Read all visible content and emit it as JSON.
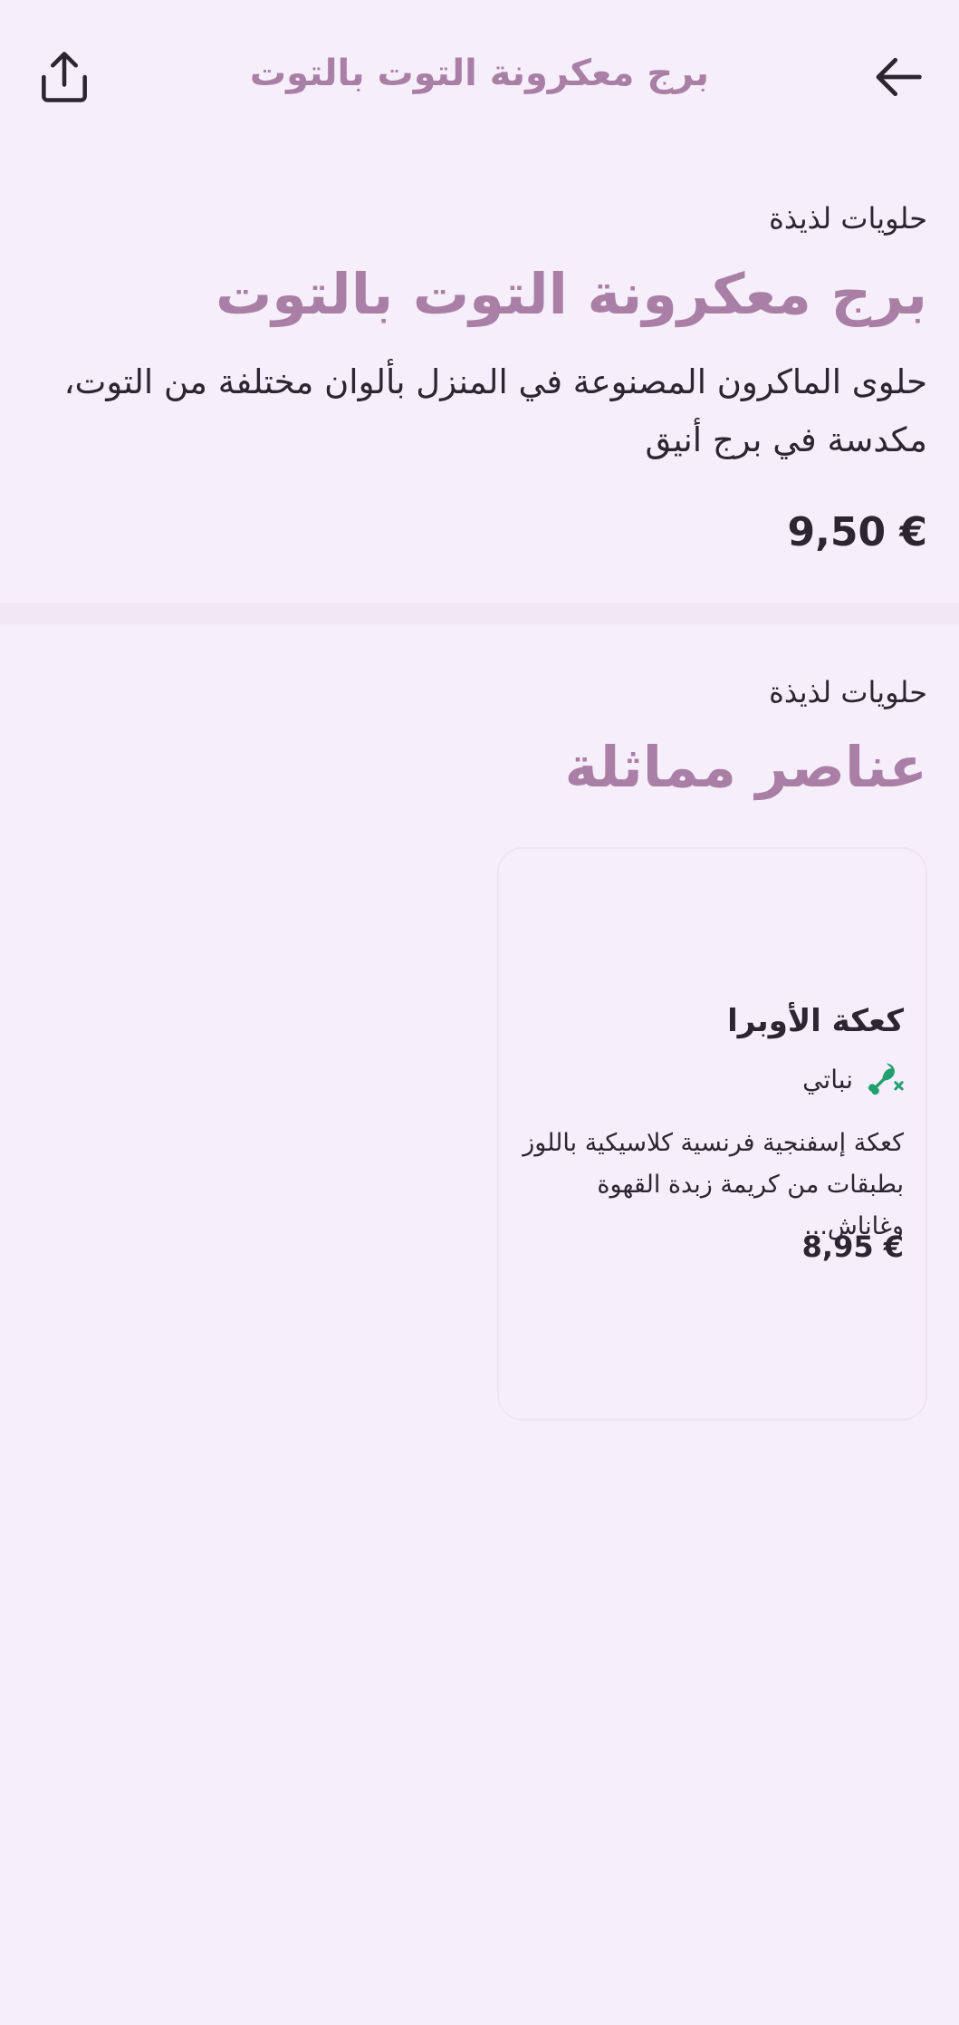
{
  "header": {
    "title": "برج معكرونة التوت بالتوت",
    "back_icon": "arrow-left-icon",
    "share_icon": "share-icon"
  },
  "product": {
    "category": "حلويات لذيذة",
    "title": "برج معكرونة التوت بالتوت",
    "description": "حلوى الماكرون المصنوعة في المنزل بألوان مختلفة من التوت، مكدسة في برج أنيق",
    "price": "9,50 €"
  },
  "similar": {
    "category": "حلويات لذيذة",
    "title": "عناصر مماثلة",
    "items": [
      {
        "title": "كعكة الأوبرا",
        "tag": "نباتي",
        "tag_icon": "drumstick-crossed-icon",
        "description": "كعكة إسفنجية فرنسية كلاسيكية باللوز بطبقات من كريمة زبدة القهوة وغاناش...",
        "price": "8,95 €"
      }
    ]
  },
  "colors": {
    "background": "#f6eefa",
    "accent": "#a97fa6",
    "text": "#2d2630",
    "tag_icon": "#1fa06e"
  }
}
